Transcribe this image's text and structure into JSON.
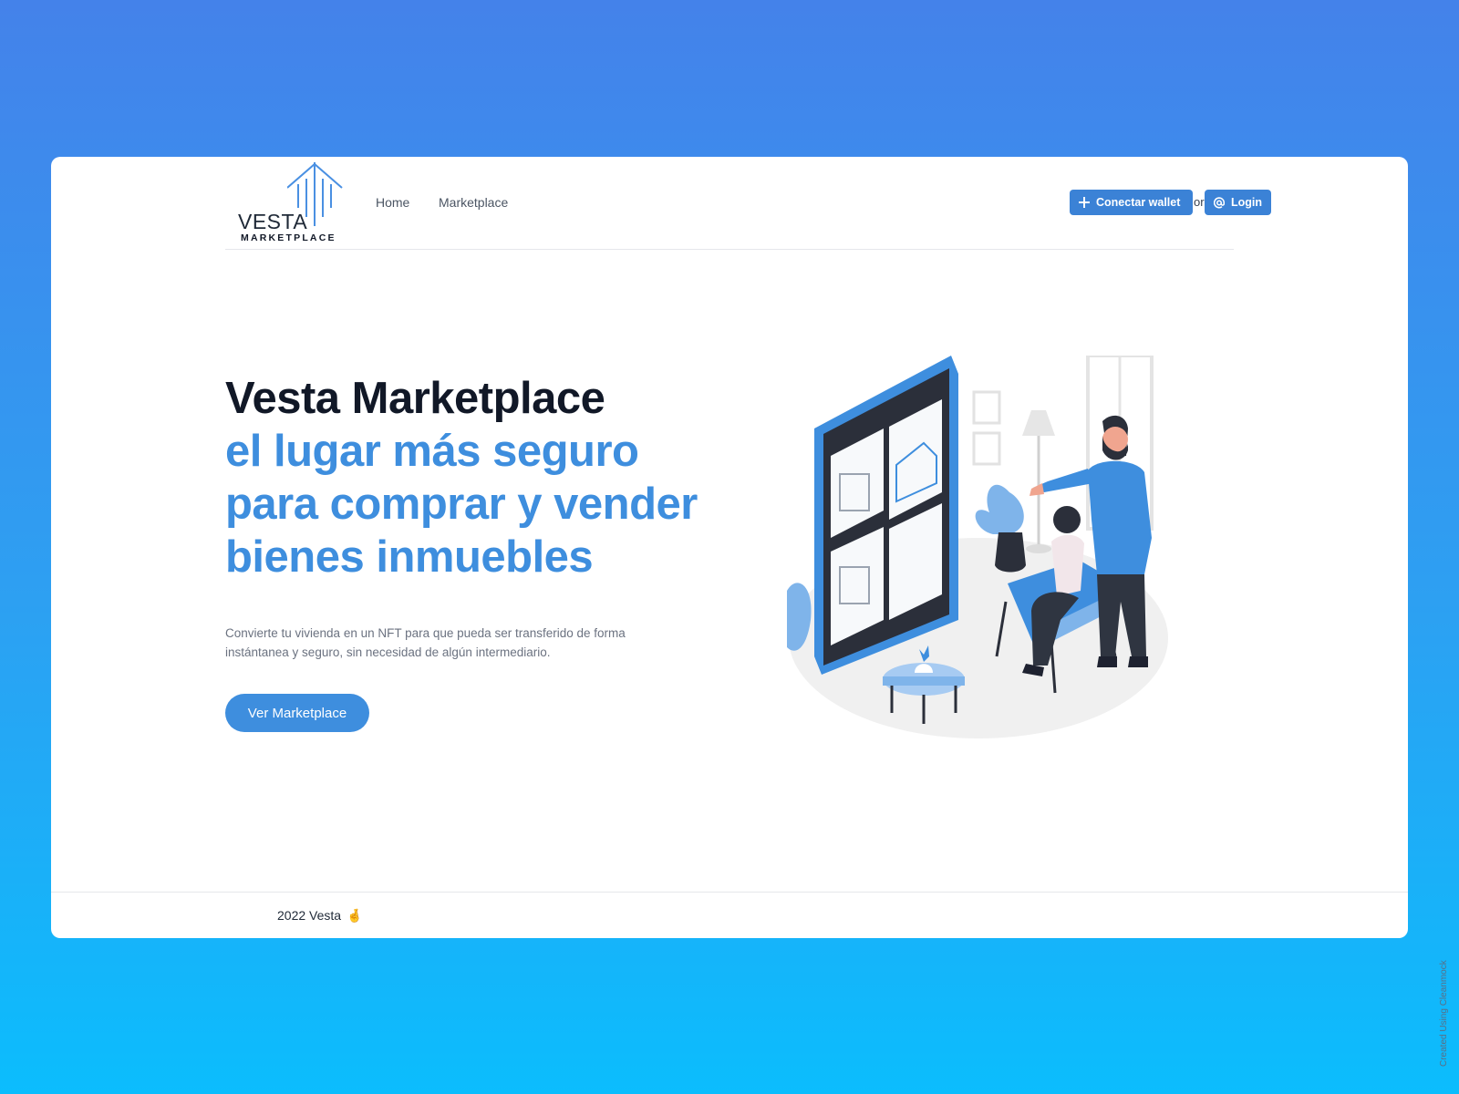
{
  "nav": {
    "logo_word": "VESTA",
    "logo_sub": "MARKETPLACE",
    "links": [
      "Home",
      "Marketplace"
    ],
    "wallet_button": "Conectar wallet",
    "or_text": "or",
    "login_button": "Login"
  },
  "hero": {
    "title_line1": "Vesta Marketplace",
    "title_line2": "el lugar más seguro",
    "title_line3": "para comprar y vender",
    "title_line4": "bienes inmuebles",
    "description": "Convierte tu vivienda en un NFT para que pueda ser transferido de forma instántanea y seguro, sin necesidad de algún intermediario.",
    "cta": "Ver Marketplace"
  },
  "footer": {
    "text": "2022 Vesta",
    "emoji": "🤞"
  },
  "watermark": "Created Using Cleanmock",
  "icons": [
    "building-logo-icon",
    "plus-icon",
    "at-icon",
    "real-estate-illustration"
  ],
  "colors": {
    "accent": "#3e8ede",
    "button": "#3b82d6",
    "background_top": "#4482ea",
    "background_bottom": "#0bbdfd"
  }
}
